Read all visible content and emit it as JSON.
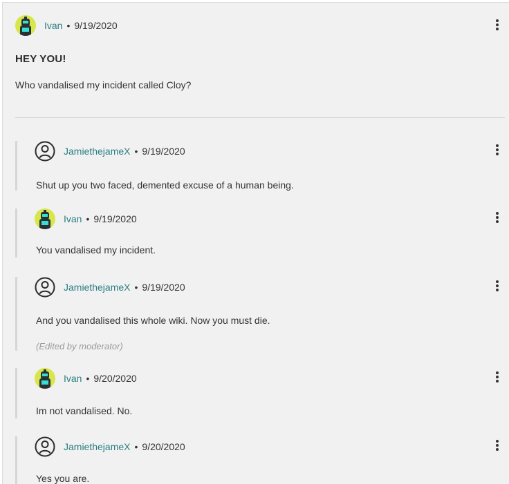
{
  "post": {
    "author": "Ivan",
    "separator": "•",
    "date": "9/19/2020",
    "title": "HEY YOU!",
    "body": "Who vandalised my incident called Cloy?"
  },
  "replies": [
    {
      "author": "JamiethejameX",
      "avatar": "user-outline-icon",
      "date": "9/19/2020",
      "text": "Shut up you two faced, demented excuse of a human being."
    },
    {
      "author": "Ivan",
      "avatar": "robot-avatar",
      "date": "9/19/2020",
      "text": "You vandalised my incident."
    },
    {
      "author": "JamiethejameX",
      "avatar": "user-outline-icon",
      "date": "9/19/2020",
      "text": "And you vandalised this whole wiki. Now you must die.",
      "edited": "(Edited by moderator)"
    },
    {
      "author": "Ivan",
      "avatar": "robot-avatar",
      "date": "9/20/2020",
      "text": "Im not vandalised. No."
    },
    {
      "author": "JamiethejameX",
      "avatar": "user-outline-icon",
      "date": "9/20/2020",
      "text": "Yes you are."
    }
  ],
  "colors": {
    "username": "#2a7e82",
    "background": "#f1f1f1",
    "avatar_bg": "#d7e64b"
  }
}
